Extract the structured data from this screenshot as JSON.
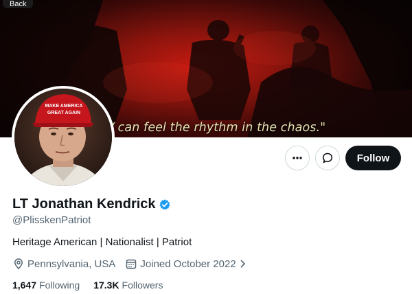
{
  "banner": {
    "back_label": "Back",
    "caption": "/ can feel the rhythm in the chaos.\""
  },
  "avatar": {
    "hat_text_line1": "MAKE AMERICA",
    "hat_text_line2": "GREAT AGAIN"
  },
  "actions": {
    "more_icon": "more-horizontal-icon",
    "message_icon": "message-bubble-icon",
    "follow_label": "Follow"
  },
  "profile": {
    "display_name": "LT Jonathan Kendrick",
    "handle": "@PlisskenPatriot",
    "bio": "Heritage American | Nationalist | Patriot",
    "location": "Pennsylvania, USA",
    "joined": "Joined October 2022",
    "verified_color": "#1d9bf0"
  },
  "stats": {
    "following_count": "1,647",
    "following_label": "Following",
    "followers_count": "17.3K",
    "followers_label": "Followers"
  }
}
